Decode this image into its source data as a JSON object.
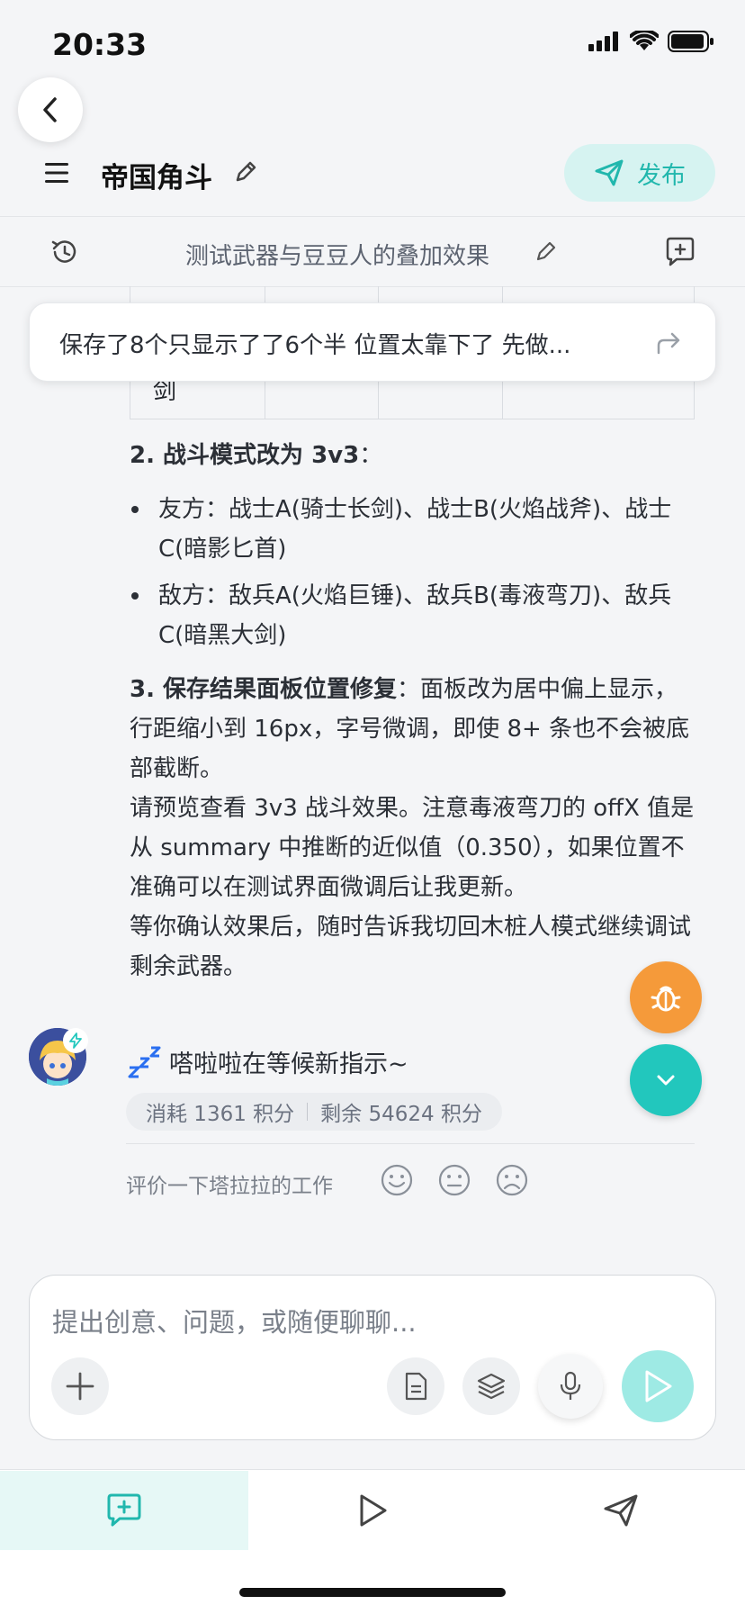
{
  "status_bar": {
    "time": "20:33"
  },
  "header": {
    "title": "帝国角斗",
    "publish_label": "发布"
  },
  "subheader": {
    "conversation_title": "测试武器与豆豆人的叠加效果"
  },
  "table_fragment": {
    "cell_text": "剑"
  },
  "pinned_banner": {
    "text": "保存了8个只显示了了6个半 位置太靠下了 先做..."
  },
  "message": {
    "section2_title": "2. 战斗模式改为 3v3",
    "section2_colon": "：",
    "bullets": [
      "友方：战士A(骑士长剑)、战士B(火焰战斧)、战士C(暗影匕首)",
      "敌方：敌兵A(火焰巨锤)、敌兵B(毒液弯刀)、敌兵C(暗黑大剑)"
    ],
    "section3_title": "3. 保存结果面板位置修复",
    "section3_body": "：面板改为居中偏上显示，行距缩小到 16px，字号微调，即使 8+ 条也不会被底部截断。",
    "para1": "请预览查看 3v3 战斗效果。注意毒液弯刀的 offX 值是从 summary 中推断的近似值（0.350），如果位置不准确可以在测试界面微调后让我更新。",
    "para2": "等你确认效果后，随时告诉我切回木桩人模式继续调试剩余武器。"
  },
  "bot_status": {
    "wait_text": "嗒啦啦在等候新指示~",
    "consumed": "消耗 1361 积分",
    "remaining": "剩余 54624 积分",
    "rate_prompt": "评价一下塔拉拉的工作"
  },
  "input": {
    "placeholder": "提出创意、问题，或随便聊聊..."
  },
  "colors": {
    "accent": "#21b7ad",
    "bug_fab": "#f59a3a",
    "send_disabled": "#9eeae4"
  }
}
